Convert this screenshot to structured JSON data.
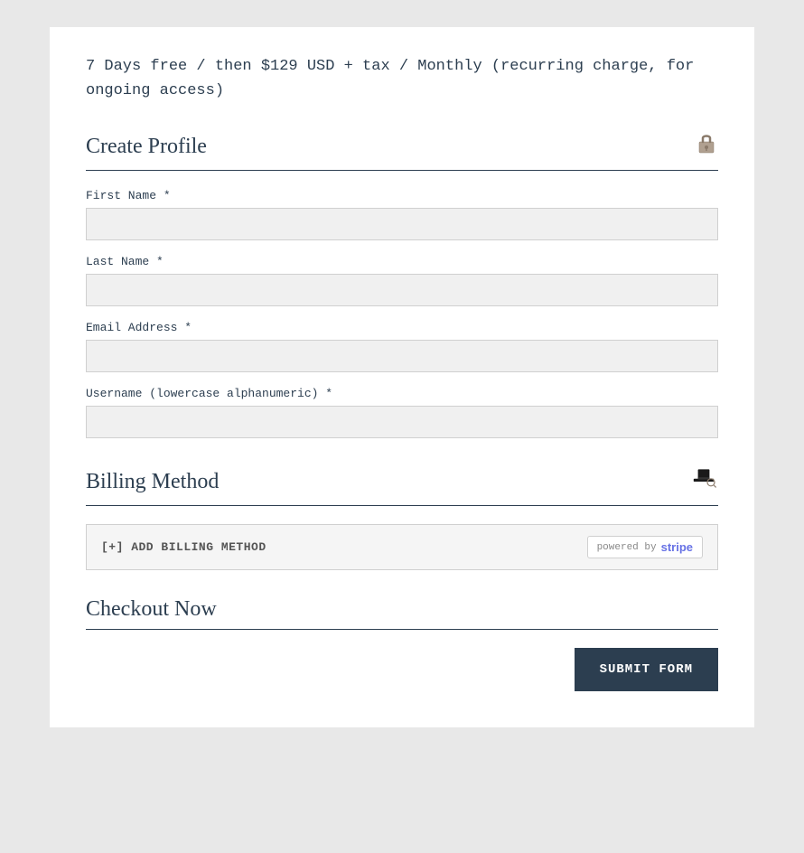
{
  "pricing": {
    "description": "7 Days free / then $129 USD + tax / Monthly (recurring charge, for ongoing access)"
  },
  "create_profile": {
    "title": "Create Profile",
    "fields": [
      {
        "label": "First Name",
        "required": true,
        "name": "first-name-input",
        "placeholder": ""
      },
      {
        "label": "Last Name",
        "required": true,
        "name": "last-name-input",
        "placeholder": ""
      },
      {
        "label": "Email Address",
        "required": true,
        "name": "email-input",
        "placeholder": ""
      },
      {
        "label": "Username (lowercase alphanumeric)",
        "required": true,
        "name": "username-input",
        "placeholder": ""
      }
    ]
  },
  "billing_method": {
    "title": "Billing Method",
    "add_label": "[+] ADD BILLING METHOD",
    "powered_by": "powered by",
    "stripe_label": "stripe"
  },
  "checkout": {
    "title": "Checkout Now",
    "submit_label": "SUBMIT FORM"
  }
}
